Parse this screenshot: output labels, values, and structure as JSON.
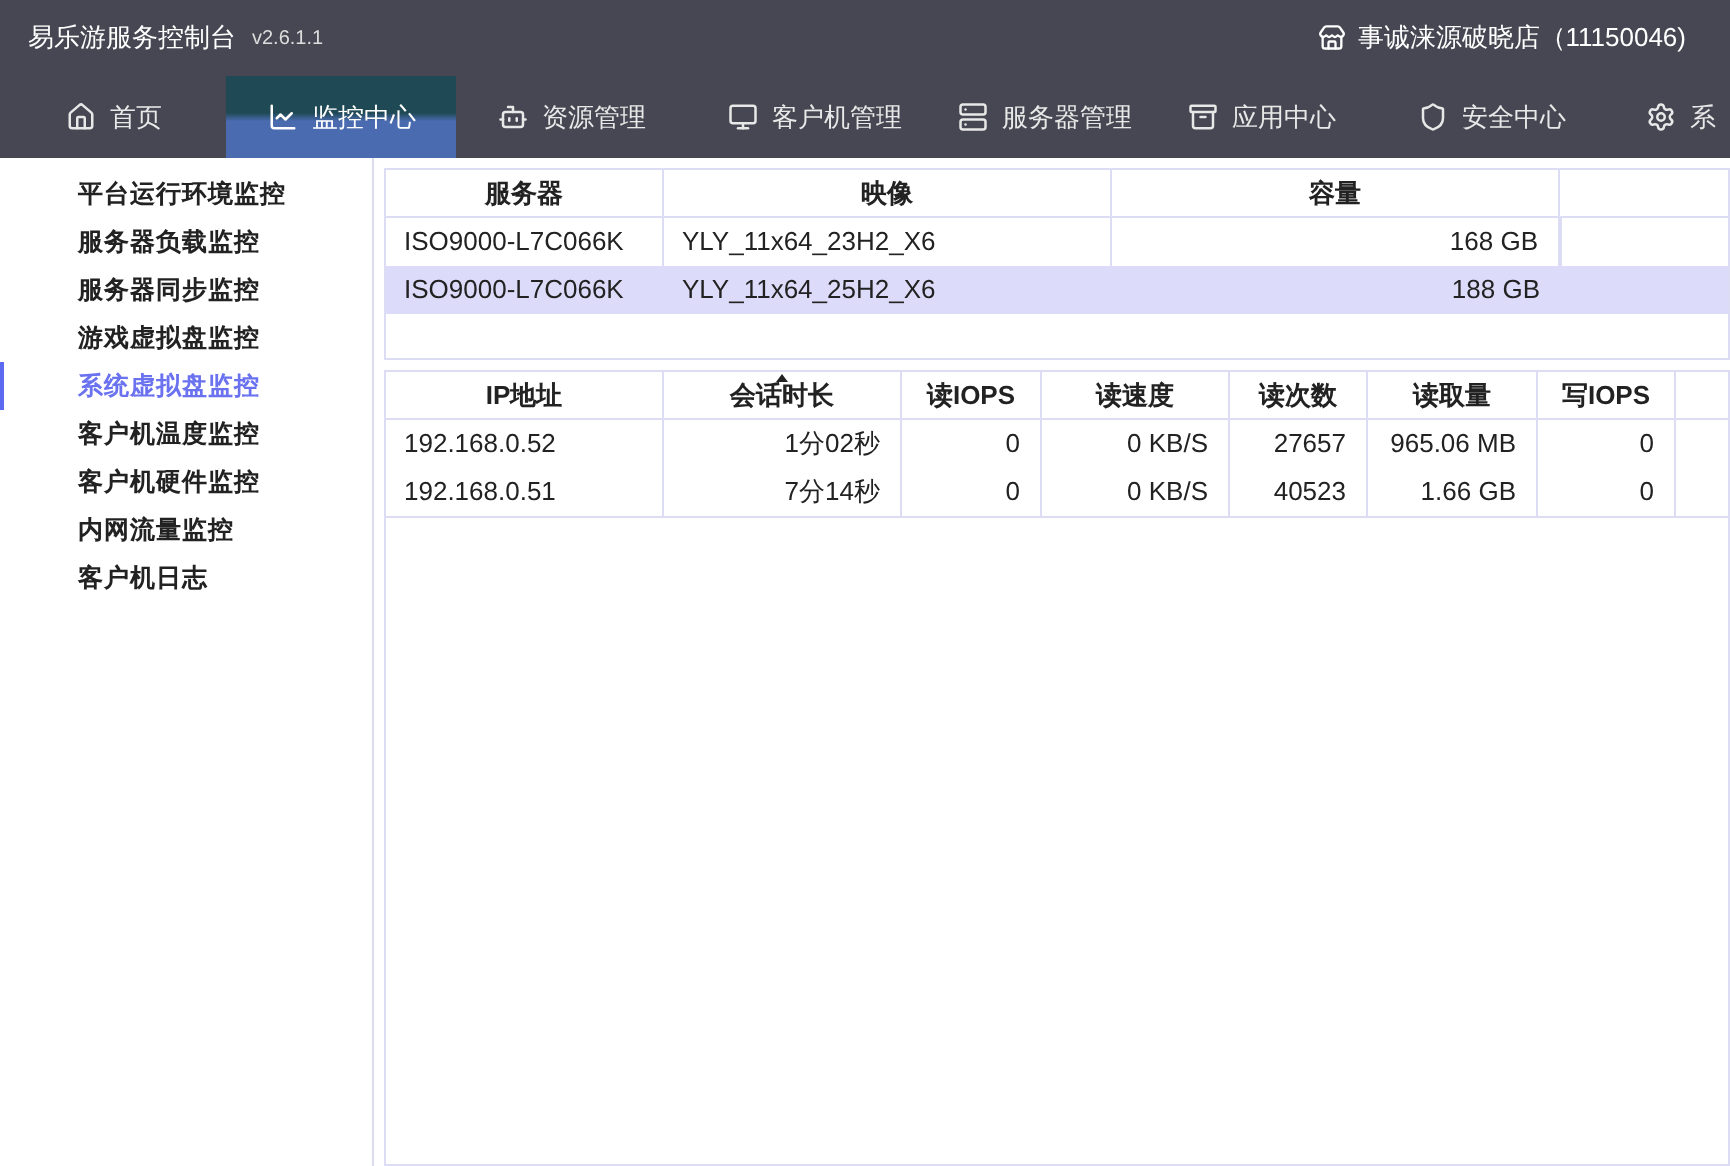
{
  "app": {
    "title": "易乐游服务控制台",
    "version": "v2.6.1.1",
    "store": "事诚涞源破晓店（11150046)"
  },
  "nav": [
    {
      "label": "首页",
      "selected": false
    },
    {
      "label": "监控中心",
      "selected": true
    },
    {
      "label": "资源管理",
      "selected": false
    },
    {
      "label": "客户机管理",
      "selected": false
    },
    {
      "label": "服务器管理",
      "selected": false
    },
    {
      "label": "应用中心",
      "selected": false
    },
    {
      "label": "安全中心",
      "selected": false
    },
    {
      "label": "系",
      "selected": false
    }
  ],
  "sidebar": {
    "items": [
      {
        "label": "平台运行环境监控",
        "selected": false
      },
      {
        "label": "服务器负载监控",
        "selected": false
      },
      {
        "label": "服务器同步监控",
        "selected": false
      },
      {
        "label": "游戏虚拟盘监控",
        "selected": false
      },
      {
        "label": "系统虚拟盘监控",
        "selected": true
      },
      {
        "label": "客户机温度监控",
        "selected": false
      },
      {
        "label": "客户机硬件监控",
        "selected": false
      },
      {
        "label": "内网流量监控",
        "selected": false
      },
      {
        "label": "客户机日志",
        "selected": false
      }
    ]
  },
  "server_table": {
    "columns": [
      "服务器",
      "映像",
      "容量"
    ],
    "rows": [
      {
        "cells": [
          "ISO9000-L7C066K",
          "YLY_11x64_23H2_X6",
          "168 GB"
        ],
        "selected": false
      },
      {
        "cells": [
          "ISO9000-L7C066K",
          "YLY_11x64_25H2_X6",
          "188 GB"
        ],
        "selected": true
      }
    ]
  },
  "session_table": {
    "columns": [
      {
        "label": "IP地址",
        "sorted": false
      },
      {
        "label": "会话时长",
        "sorted": true
      },
      {
        "label": "读IOPS",
        "sorted": false
      },
      {
        "label": "读速度",
        "sorted": false
      },
      {
        "label": "读次数",
        "sorted": false
      },
      {
        "label": "读取量",
        "sorted": false
      },
      {
        "label": "写IOPS",
        "sorted": false
      }
    ],
    "rows": [
      [
        "192.168.0.52",
        "1分02秒",
        "0",
        "0 KB/S",
        "27657",
        "965.06 MB",
        "0"
      ],
      [
        "192.168.0.51",
        "7分14秒",
        "0",
        "0 KB/S",
        "40523",
        "1.66 GB",
        "0"
      ]
    ]
  }
}
